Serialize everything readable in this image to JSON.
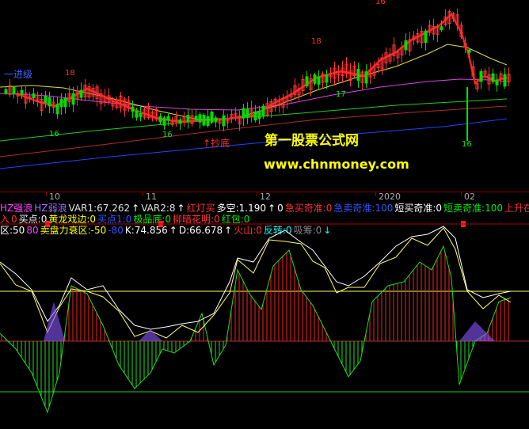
{
  "main_chart": {
    "annotations": {
      "left_label": "一进级",
      "bottom_label": "抄底"
    },
    "watermark": {
      "title": "第一股票公式网",
      "url": "www.chnmoney.com"
    },
    "numbers": [
      "18",
      "16",
      "16",
      "16",
      "18",
      "17",
      "16"
    ]
  },
  "time_axis": {
    "labels": [
      "10",
      "11",
      "12",
      "2020",
      "02"
    ]
  },
  "legend_line1": [
    {
      "text": "HZ强浪",
      "color": "#ff44ff"
    },
    {
      "text": "HZ弱浪",
      "color": "#a070ff"
    },
    {
      "text": "VAR1:67.262",
      "color": "#e0e0e0"
    },
    {
      "text": "↑",
      "color": "#ffffff"
    },
    {
      "text": "VAR2:8",
      "color": "#e0e0e0"
    },
    {
      "text": "↑",
      "color": "#ffffff"
    },
    {
      "text": "红灯买",
      "color": "#ff3333"
    },
    {
      "text": "多空:1.190",
      "color": "#ffffff"
    },
    {
      "text": "↑",
      "color": "#ffffff"
    },
    {
      "text": "0",
      "color": "#ffffff"
    },
    {
      "text": "急买奇准:0",
      "color": "#ff3333"
    },
    {
      "text": "急卖奇准:100",
      "color": "#3355ff"
    },
    {
      "text": "短买奇准:0",
      "color": "#ffffff"
    },
    {
      "text": "短卖奇准:100",
      "color": "#00ee00"
    },
    {
      "text": "上升在",
      "color": "#ff3333"
    }
  ],
  "legend_line2": [
    {
      "text": "入",
      "color": "#ff3333"
    },
    {
      "text": "0",
      "color": "#ff3333"
    },
    {
      "text": "买点:0",
      "color": "#ffffff"
    },
    {
      "text": "黄龙戏边:0",
      "color": "#ffff00"
    },
    {
      "text": "买点1:0",
      "color": "#3355ff"
    },
    {
      "text": "极品底:0",
      "color": "#00ee00"
    },
    {
      "text": "柳暗花明:0",
      "color": "#ff3333"
    },
    {
      "text": "红包:0",
      "color": "#00ee00"
    }
  ],
  "legend_line3": [
    {
      "text": "区:50",
      "color": "#ffffff"
    },
    {
      "text": "80",
      "color": "#ff44ff"
    },
    {
      "text": "卖盘力衰区:-50",
      "color": "#ffff00"
    },
    {
      "text": "-80",
      "color": "#3355ff"
    },
    {
      "text": "K:74.856",
      "color": "#ffffff"
    },
    {
      "text": "↑",
      "color": "#ffffff"
    },
    {
      "text": "D:66.678",
      "color": "#ffffff"
    },
    {
      "text": "↑",
      "color": "#ffffff"
    },
    {
      "text": "火山:0",
      "color": "#ff3333"
    },
    {
      "text": "反转:0",
      "color": "#00ffff"
    },
    {
      "text": "吸筹:0",
      "color": "#888888"
    },
    {
      "text": "↓",
      "color": "#00ffff"
    }
  ],
  "colors": {
    "up": "#ff3333",
    "down": "#00dd00",
    "ma_red": "#ff2020",
    "ma_yellow": "#dddd40",
    "ma_magenta": "#dd44dd",
    "ma_green": "#22cc22",
    "ma_brown": "#aa3030",
    "ma_blue": "#2244ff",
    "k_line": "#ffffff",
    "d_line": "#ffff66"
  }
}
